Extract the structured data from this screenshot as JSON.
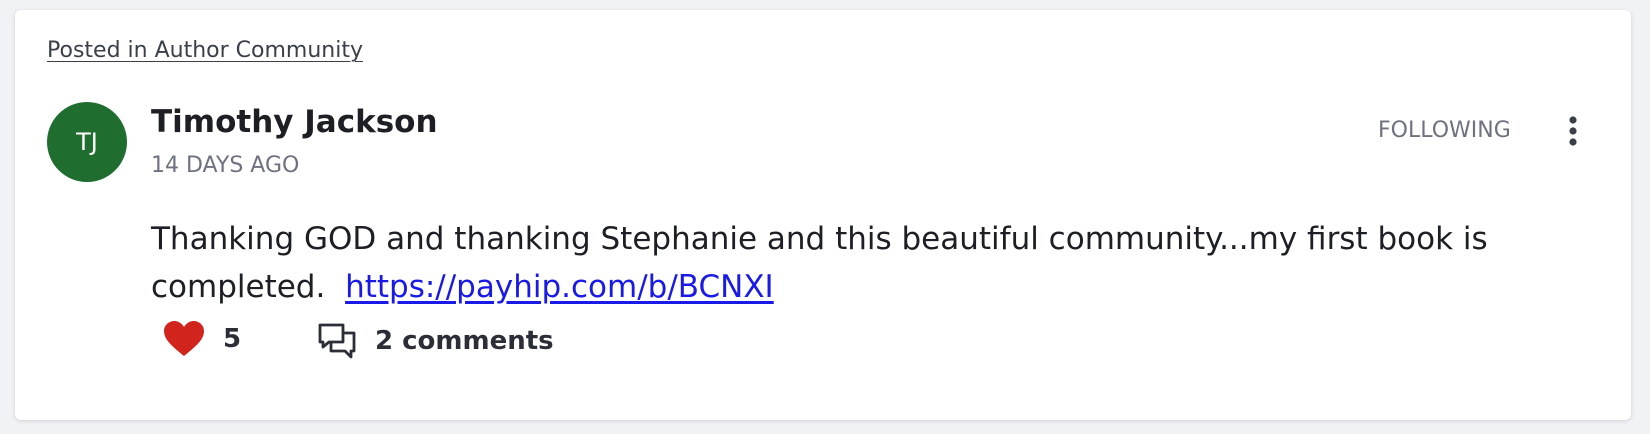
{
  "post": {
    "posted_in": "Posted in Author Community",
    "author": {
      "initials": "TJ",
      "name": "Timothy Jackson",
      "avatar_color": "#1f6d2f"
    },
    "time": "14 DAYS AGO",
    "follow_label": "FOLLOWING",
    "body_text": "Thanking GOD and thanking Stephanie and this beautiful community...my first book is completed.",
    "link": "https://payhip.com/b/BCNXI",
    "likes": {
      "count": "5",
      "icon": "heart-icon",
      "color": "#d0241c"
    },
    "comments": {
      "label": "2 comments",
      "icon": "comment-bubbles-icon"
    },
    "more_icon": "vertical-dots-icon"
  }
}
